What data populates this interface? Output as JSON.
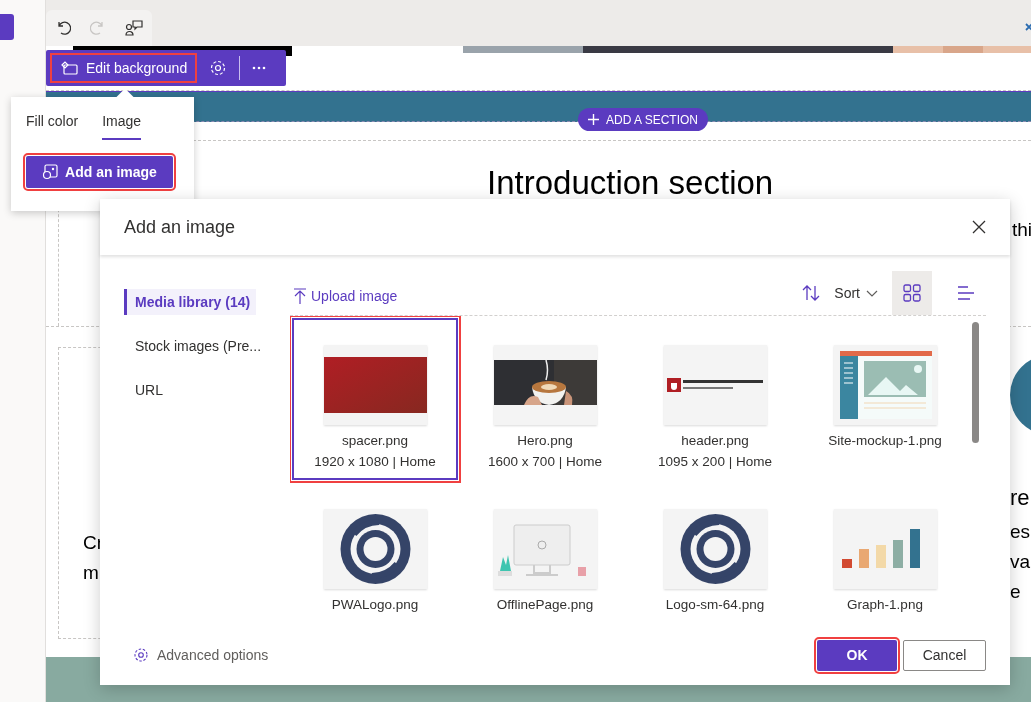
{
  "editor_toolbar": [
    {
      "kind": "undo",
      "disabled": false
    },
    {
      "kind": "redo",
      "disabled": true
    },
    {
      "kind": "people",
      "disabled": false
    }
  ],
  "section_toolbar": {
    "edit_background": {
      "label": "Edit background",
      "highlighted": true
    }
  },
  "add_section": {
    "label": "ADD A SECTION"
  },
  "background_popover": {
    "tabs": [
      {
        "label": "Fill color",
        "selected": false
      },
      {
        "label": "Image",
        "selected": true
      }
    ],
    "add_image": {
      "label": "Add an image",
      "highlighted": true
    }
  },
  "page": {
    "intro_heading": "Introduction section",
    "intro_fragment": "thi",
    "left_fragments": [
      "Cr",
      "m"
    ],
    "right_heading_fragment": "re",
    "right_fragments": [
      "es",
      "va",
      "e"
    ]
  },
  "dialog": {
    "title": "Add an image",
    "nav": [
      {
        "label": "Media library (14)",
        "selected": true
      },
      {
        "label": "Stock images (Pre...",
        "selected": false
      },
      {
        "label": "URL",
        "selected": false
      }
    ],
    "upload": "Upload image",
    "sort": "Sort",
    "views": [
      {
        "kind": "grid",
        "selected": true
      },
      {
        "kind": "list",
        "selected": false
      }
    ],
    "tiles": [
      {
        "name": "spacer.png",
        "meta": "1920 x 1080 | Home",
        "kind": "gradient",
        "selected": true,
        "highlighted": true
      },
      {
        "name": "Hero.png",
        "meta": "1600 x 700 | Home",
        "selected": false,
        "highlighted": false
      },
      {
        "name": "header.png",
        "meta": "1095 x 200 | Home",
        "kind": "banner",
        "selected": false,
        "highlighted": false
      },
      {
        "name": "Site-mockup-1.png",
        "kind": "mockup",
        "selected": false,
        "highlighted": false
      },
      {
        "name": "PWALogo.png",
        "kind": "ring",
        "selected": false,
        "highlighted": false
      },
      {
        "name": "OfflinePage.png",
        "kind": "offline",
        "selected": false,
        "highlighted": false
      },
      {
        "name": "Logo-sm-64.png",
        "kind": "ring",
        "selected": false,
        "highlighted": false
      },
      {
        "name": "Graph-1.png",
        "kind": "bars",
        "selected": false,
        "highlighted": false
      }
    ],
    "advanced": "Advanced options",
    "ok": {
      "label": "OK",
      "highlighted": true
    },
    "cancel": "Cancel"
  }
}
